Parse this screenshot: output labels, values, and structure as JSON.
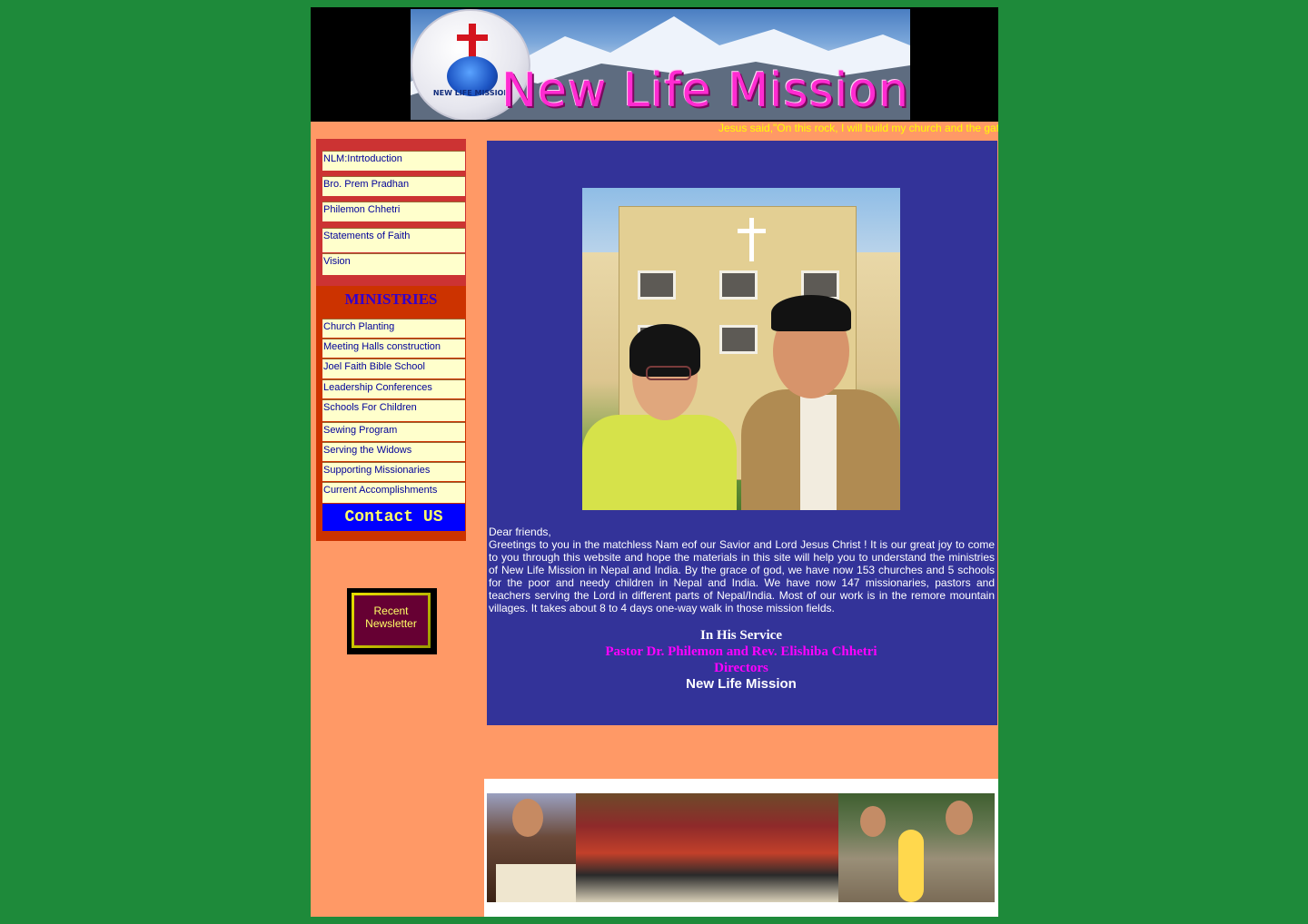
{
  "banner": {
    "title": "New Life Mission",
    "logo_text": "NEW LIFE MISSION"
  },
  "marquee": {
    "text": "Jesus said,\"On this rock, I will build my church and the gat"
  },
  "sidebar": {
    "about_items": [
      "NLM:Intrtoduction",
      "Bro. Prem Pradhan",
      "Philemon Chhetri",
      "Statements of Faith",
      "Vision"
    ],
    "ministries_heading": "MINISTRIES",
    "ministry_items": [
      "Church Planting",
      "Meeting Halls construction",
      "Joel Faith Bible School",
      "Leadership Conferences",
      "Schools For Children",
      "Sewing Program",
      "Serving the Widows",
      "Supporting Missionaries",
      "Current Accomplishments"
    ],
    "contact_label": "Contact US"
  },
  "newsletter": {
    "label_line1": "Recent",
    "label_line2": "Newsletter"
  },
  "main": {
    "greeting": "Dear friends,",
    "letter": "Greetings to you in the matchless Nam eof our Savior and Lord Jesus Christ ! It is our great joy to come to you through this website and hope the materials in this site will help you to understand the ministries of New Life Mission in Nepal and India. By the grace of god, we have now 153 churches and 5 schools for the poor and needy children in Nepal and India. We have now 147 missionaries, pastors and teachers serving the Lord in different parts of Nepal/India. Most of our work is in the remore mountain villages. It takes about 8 to 4 days one-way walk in those mission fields.",
    "sign_intro": "In His Service",
    "sign_names": "Pastor Dr. Philemon and Rev. Elishiba Chhetri",
    "sign_role": "Directors",
    "sign_org": "New Life Mission"
  },
  "colors": {
    "page_bg": "#1e8a3a",
    "content_bg": "#ff9966",
    "panel_blue": "#333399",
    "nav_bg": "#ffffcc",
    "nav_text": "#000099",
    "accent_magenta": "#ff00ff"
  }
}
